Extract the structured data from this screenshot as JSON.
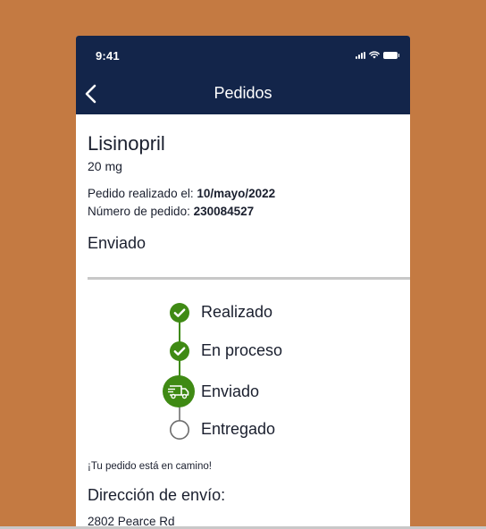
{
  "status_bar": {
    "time": "9:41"
  },
  "nav": {
    "title": "Pedidos"
  },
  "order": {
    "product_name": "Lisinopril",
    "dose": "20 mg",
    "placed_label": "Pedido realizado el: ",
    "placed_date": "10/mayo/2022",
    "number_label": "Número de pedido: ",
    "number": "230084527",
    "status": "Enviado"
  },
  "timeline": {
    "steps": [
      {
        "label": "Realizado",
        "state": "done"
      },
      {
        "label": "En proceso",
        "state": "done"
      },
      {
        "label": "Enviado",
        "state": "current"
      },
      {
        "label": "Entregado",
        "state": "pending"
      }
    ]
  },
  "transit_message": "¡Tu pedido está en camino!",
  "shipping": {
    "title": "Dirección de envío:",
    "line1": "2802 Pearce Rd"
  },
  "colors": {
    "background": "#c47a42",
    "header": "#13254a",
    "accent_green": "#3f8a14"
  }
}
